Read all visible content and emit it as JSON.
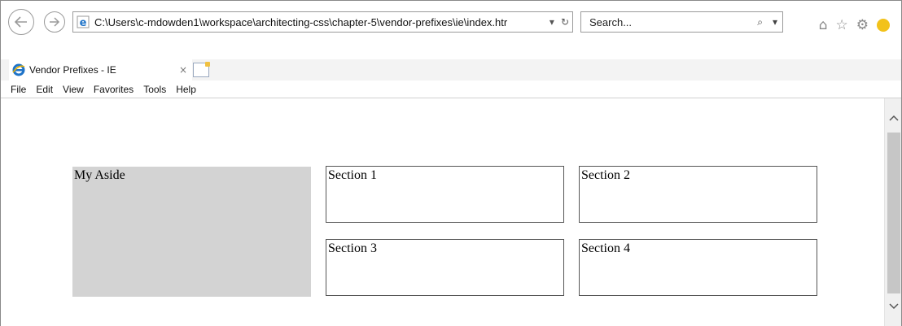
{
  "window": {
    "controls": {
      "minimize": "–",
      "maximize": "☐",
      "close": "✕"
    }
  },
  "nav": {
    "back_icon": "back-arrow-icon",
    "forward_icon": "forward-arrow-icon"
  },
  "address_bar": {
    "url": "C:\\Users\\c-mdowden1\\workspace\\architecting-css\\chapter-5\\vendor-prefixes\\ie\\index.htr",
    "dropdown": "▾",
    "refresh": "↻"
  },
  "search": {
    "placeholder": "Search...",
    "icon": "⌕",
    "dropdown": "▾"
  },
  "toolbar": {
    "home_icon": "⌂",
    "favorites_icon": "☆",
    "settings_icon": "⚙"
  },
  "tab": {
    "title": "Vendor Prefixes - IE",
    "close": "×"
  },
  "menu": {
    "items": [
      "File",
      "Edit",
      "View",
      "Favorites",
      "Tools",
      "Help"
    ]
  },
  "page": {
    "aside": "My Aside",
    "sections": [
      "Section 1",
      "Section 2",
      "Section 3",
      "Section 4"
    ]
  },
  "scrollbar": {
    "up": "^",
    "down": "v"
  },
  "colors": {
    "aside_bg": "#d3d3d3",
    "ie_blue": "#1e73c8",
    "smiley": "#f2c21a"
  }
}
